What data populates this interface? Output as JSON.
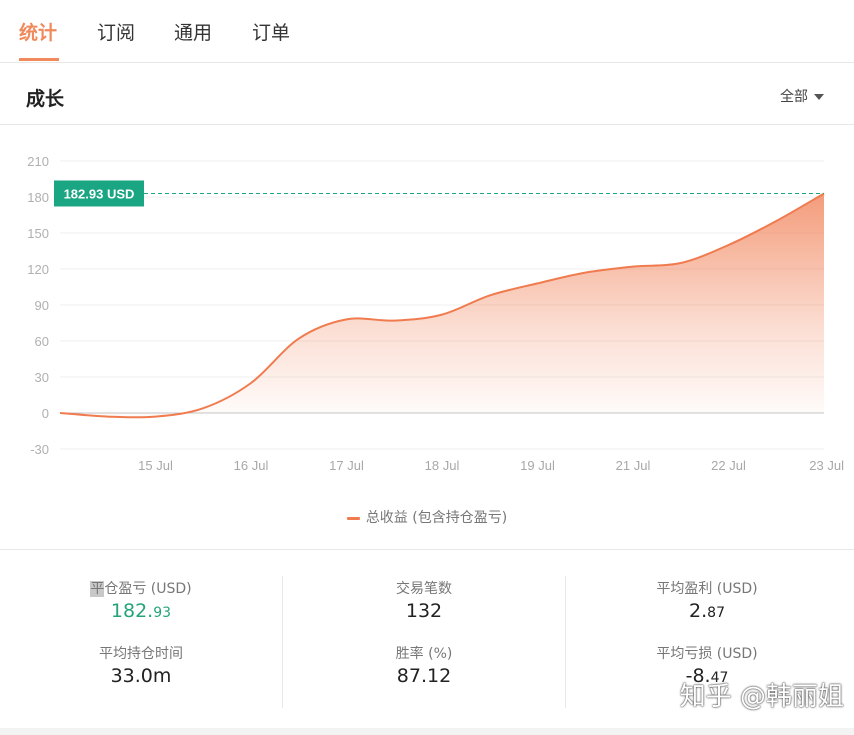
{
  "tabs": [
    {
      "label": "统计",
      "active": true
    },
    {
      "label": "订阅",
      "active": false
    },
    {
      "label": "通用",
      "active": false
    },
    {
      "label": "订单",
      "active": false
    }
  ],
  "section": {
    "title": "成长",
    "filter_label": "全部"
  },
  "chart_data": {
    "type": "area",
    "title": "",
    "xlabel": "",
    "ylabel": "",
    "ylim": [
      -30,
      210
    ],
    "yticks": [
      "210",
      "180",
      "150",
      "120",
      "90",
      "60",
      "30",
      "0",
      "-30"
    ],
    "xticks": [
      "15 Jul",
      "16 Jul",
      "17 Jul",
      "18 Jul",
      "19 Jul",
      "21 Jul",
      "22 Jul",
      "23 Jul"
    ],
    "series": [
      {
        "name": "总收益 (包含持仓盈亏)",
        "color": "#f07b4f",
        "x": [
          -1.0,
          -0.5,
          0.0,
          0.5,
          1.0,
          1.5,
          2.0,
          2.5,
          3.0,
          3.5,
          4.0,
          4.5,
          5.0,
          5.5,
          6.0,
          6.5,
          7.0
        ],
        "values": [
          0,
          -3,
          -3,
          4,
          25,
          62,
          78,
          77,
          82,
          98,
          108,
          117,
          122,
          125,
          140,
          160,
          182.93
        ]
      }
    ],
    "current_value_label": "182.93 USD",
    "grid": true,
    "legend_position": "bottom-center"
  },
  "stats": {
    "closed_pnl_label": "平仓盈亏 (USD)",
    "closed_pnl_highlight": "平",
    "closed_pnl_rest": "仓盈亏 (USD)",
    "closed_pnl_int": "182.",
    "closed_pnl_dec": "93",
    "trades_label": "交易笔数",
    "trades_value": "132",
    "avg_profit_label": "平均盈利 (USD)",
    "avg_profit_int": "2.",
    "avg_profit_dec": "87",
    "avg_hold_label": "平均持仓时间",
    "avg_hold_value": "33.0m",
    "win_rate_label": "胜率 (%)",
    "win_rate_value": "87.12",
    "avg_loss_label": "平均亏损 (USD)",
    "avg_loss_int": "-8.",
    "avg_loss_dec": "47"
  },
  "watermark": "知乎 @韩丽姐",
  "colors": {
    "accent": "#f08a5d",
    "line": "#f07b4f",
    "badge": "#1aa583",
    "positive": "#25a47a"
  }
}
